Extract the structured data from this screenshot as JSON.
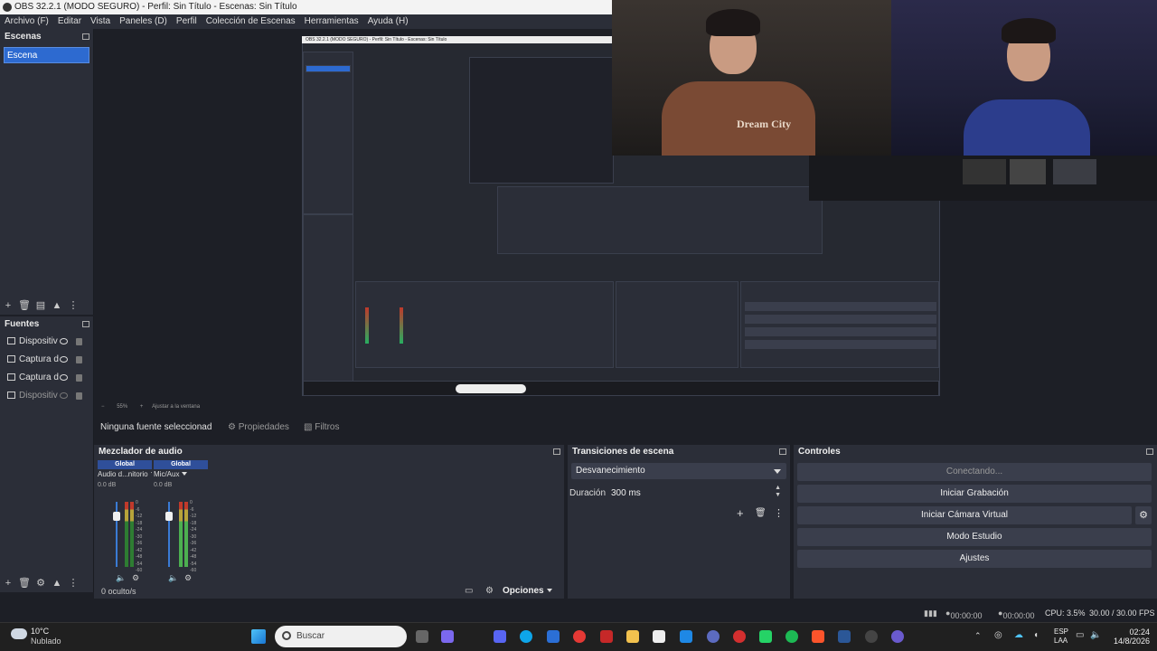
{
  "window": {
    "title": "OBS 32.2.1 (MODO SEGURO) - Perfil: Sin Título - Escenas: Sin Título"
  },
  "menu": [
    "Archivo (F)",
    "Editar",
    "Vista",
    "Paneles (D)",
    "Perfil",
    "Colección de Escenas",
    "Herramientas",
    "Ayuda (H)"
  ],
  "scenes": {
    "title": "Escenas",
    "items": [
      "Escena"
    ]
  },
  "sources": {
    "title": "Fuentes",
    "items": [
      {
        "label": "Dispositiv"
      },
      {
        "label": "Captura d"
      },
      {
        "label": "Captura d"
      },
      {
        "label": "Dispositiv"
      }
    ]
  },
  "preview": {
    "zoom": "55%",
    "fit": "Ajustar a la ventana",
    "nested_title": "OBS 32.2.1 (MODO SEGURO) - Perfil: Sin Título - Escenas: Sin Título",
    "webcam_shirt_text": "Dream City"
  },
  "toolbar": {
    "no_source": "Ninguna fuente seleccionad",
    "properties": "Propiedades",
    "filters": "Filtros"
  },
  "mixer": {
    "title": "Mezclador de audio",
    "channels": [
      {
        "global": "Global",
        "name": "Audio d...nitorio",
        "db": "0.0 dB"
      },
      {
        "global": "Global",
        "name": "Mic/Aux",
        "db": "0.0 dB"
      }
    ],
    "scale": [
      "0",
      "-6",
      "-12",
      "-18",
      "-24",
      "-30",
      "-36",
      "-42",
      "-48",
      "-54",
      "-60"
    ],
    "hidden": "0 oculto/s",
    "options": "Opciones"
  },
  "transitions": {
    "title": "Transiciones de escena",
    "selected": "Desvanecimiento",
    "duration_label": "Duración",
    "duration_value": "300 ms"
  },
  "controls": {
    "title": "Controles",
    "connecting": "Conectando...",
    "start_recording": "Iniciar Grabación",
    "start_virtual_cam": "Iniciar Cámara Virtual",
    "studio_mode": "Modo Estudio",
    "settings": "Ajustes"
  },
  "status": {
    "rec_time": "00:00:00",
    "stream_time": "00:00:00",
    "cpu": "CPU: 3.5%",
    "fps": "30.00 / 30.00 FPS"
  },
  "taskbar": {
    "weather_temp": "10°C",
    "weather_desc": "Nublado",
    "search_placeholder": "Buscar",
    "lang": "ESP",
    "lang2": "LAA",
    "time": "02:24",
    "date": "14/8/2026"
  }
}
